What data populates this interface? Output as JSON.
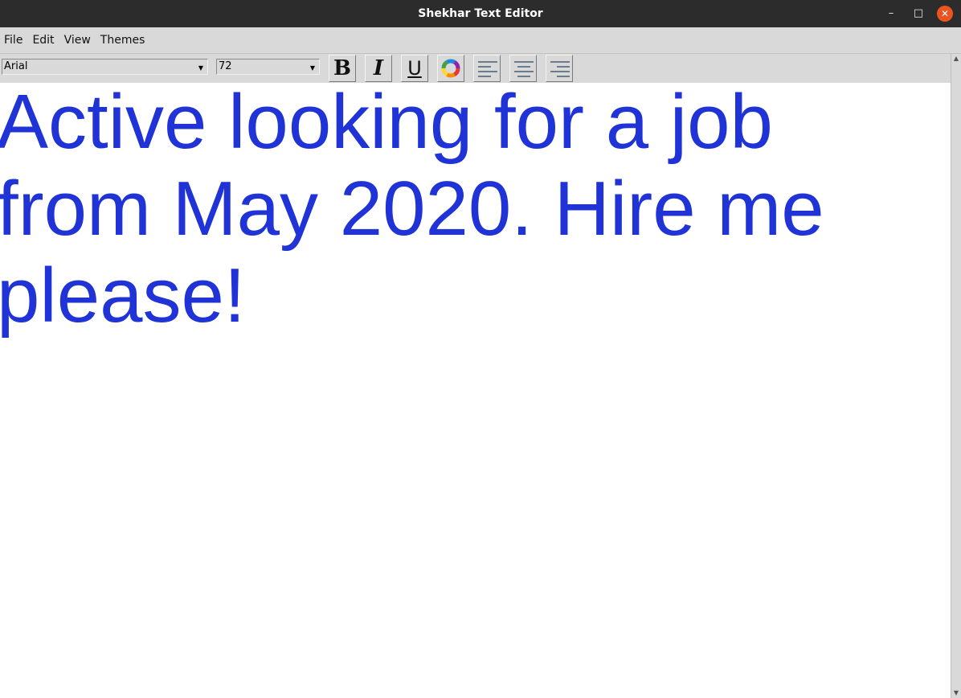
{
  "window": {
    "title": "Shekhar Text Editor",
    "minimize_icon": "minimize-icon",
    "maximize_icon": "maximize-icon",
    "close_icon": "close-icon",
    "minimize_glyph": "–",
    "maximize_glyph": "□",
    "close_glyph": "✕",
    "close_color": "#e95420"
  },
  "menubar": {
    "items": [
      {
        "label": "File"
      },
      {
        "label": "Edit"
      },
      {
        "label": "View"
      },
      {
        "label": "Themes"
      }
    ]
  },
  "toolbar": {
    "font_family": {
      "value": "Arial"
    },
    "font_size": {
      "value": "72"
    },
    "bold": {
      "label": "B",
      "icon": "bold-icon"
    },
    "italic": {
      "label": "I",
      "icon": "italic-icon"
    },
    "underline": {
      "label": "U",
      "icon": "underline-icon"
    },
    "color": {
      "icon": "color-wheel-icon"
    },
    "align_left": {
      "icon": "align-left-icon"
    },
    "align_center": {
      "icon": "align-center-icon"
    },
    "align_right": {
      "icon": "align-right-icon"
    }
  },
  "editor": {
    "text": "Active looking for a job from May 2020. Hire me please!",
    "text_color": "#1f33d6"
  },
  "colors": {
    "titlebar": "#2c2c2c",
    "chrome": "#d9d9d9",
    "close_button": "#e95420"
  }
}
